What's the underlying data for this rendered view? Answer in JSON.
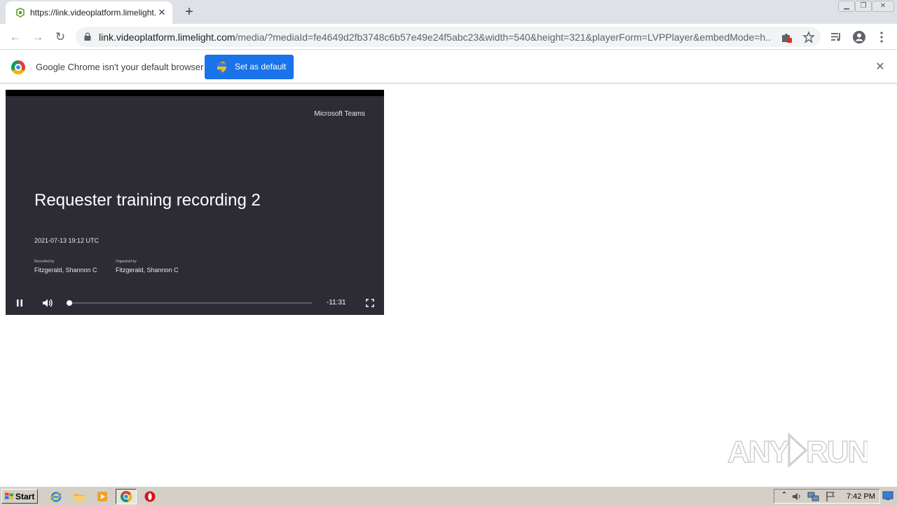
{
  "browser": {
    "tab": {
      "title": "https://link.videoplatform.limelight.c",
      "close_glyph": "✕"
    },
    "new_tab_glyph": "+",
    "window_controls": [
      "minimize-icon",
      "restore-icon",
      "close-icon"
    ],
    "address_bar": {
      "host": "link.videoplatform.limelight.com",
      "path": "/media/?mediaId=fe4649d2fb3748c6b57e49e24f5abc23&width=540&height=321&playerForm=LVPPlayer&embedMode=h..."
    }
  },
  "infobar": {
    "message": "Google Chrome isn't your default browser",
    "button_label": "Set as default",
    "close_glyph": "✕"
  },
  "player": {
    "brand": "Microsoft Teams",
    "title": "Requester training recording 2",
    "date": "2021-07-13 19:12 UTC",
    "recorded_by_label": "Recorded by",
    "recorded_by": "Fitzgerald, Shannon C",
    "organized_by_label": "Organized by",
    "organized_by": "Fitzgerald, Shannon C",
    "time_remaining": "-11:31",
    "progress": 0.0
  },
  "watermark": {
    "text": "ANY RUN"
  },
  "taskbar": {
    "start_label": "Start",
    "apps": [
      "ie-icon",
      "explorer-icon",
      "media-player-icon",
      "chrome-icon",
      "opera-icon"
    ],
    "clock": "7:42 PM"
  },
  "colors": {
    "accent": "#1a73e8",
    "slide_bg": "#2d2c35",
    "taskbar": "#d4d0c8"
  }
}
